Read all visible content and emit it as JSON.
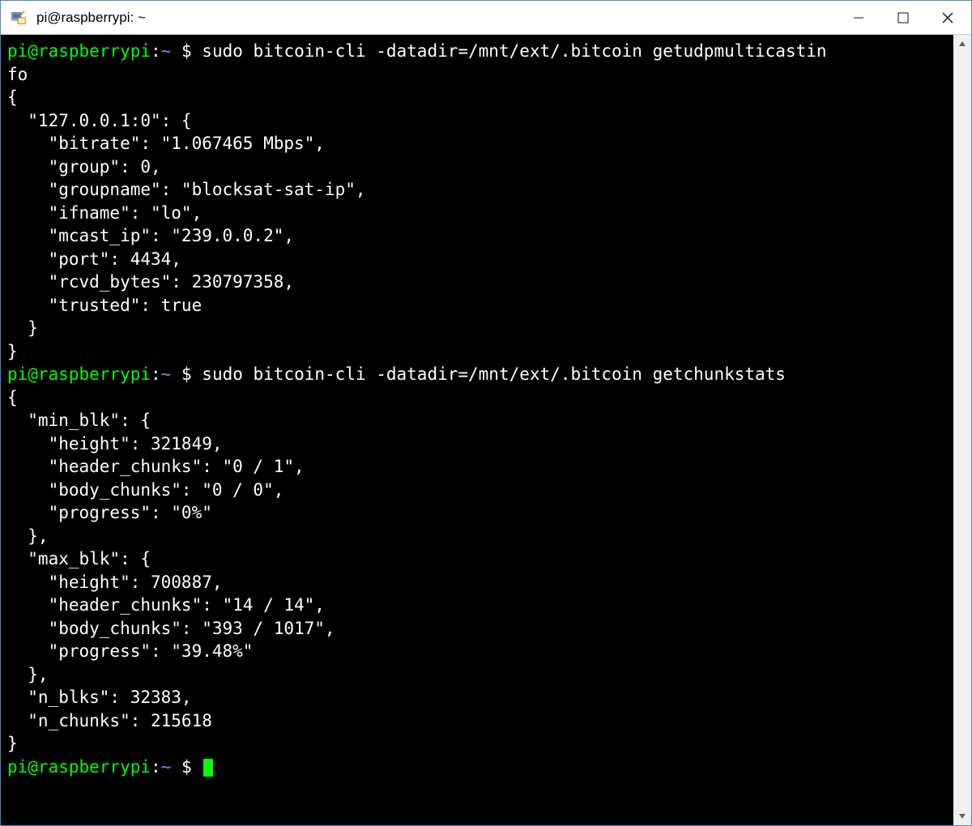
{
  "window": {
    "title": "pi@raspberrypi: ~"
  },
  "prompt": {
    "user_host": "pi@raspberrypi",
    "path": "~",
    "symbol": "$"
  },
  "commands": {
    "cmd1": "sudo bitcoin-cli -datadir=/mnt/ext/.bitcoin getudpmulticastin",
    "cmd1_wrap": "fo",
    "cmd2": "sudo bitcoin-cli -datadir=/mnt/ext/.bitcoin getchunkstats"
  },
  "output1": {
    "l0": "{",
    "l1": "  \"127.0.0.1:0\": {",
    "l2": "    \"bitrate\": \"1.067465 Mbps\",",
    "l3": "    \"group\": 0,",
    "l4": "    \"groupname\": \"blocksat-sat-ip\",",
    "l5": "    \"ifname\": \"lo\",",
    "l6": "    \"mcast_ip\": \"239.0.0.2\",",
    "l7": "    \"port\": 4434,",
    "l8": "    \"rcvd_bytes\": 230797358,",
    "l9": "    \"trusted\": true",
    "l10": "  }",
    "l11": "}"
  },
  "output2": {
    "l0": "{",
    "l1": "  \"min_blk\": {",
    "l2": "    \"height\": 321849,",
    "l3": "    \"header_chunks\": \"0 / 1\",",
    "l4": "    \"body_chunks\": \"0 / 0\",",
    "l5": "    \"progress\": \"0%\"",
    "l6": "  },",
    "l7": "  \"max_blk\": {",
    "l8": "    \"height\": 700887,",
    "l9": "    \"header_chunks\": \"14 / 14\",",
    "l10": "    \"body_chunks\": \"393 / 1017\",",
    "l11": "    \"progress\": \"39.48%\"",
    "l12": "  },",
    "l13": "  \"n_blks\": 32383,",
    "l14": "  \"n_chunks\": 215618",
    "l15": "}"
  },
  "colon": ":",
  "space": " "
}
